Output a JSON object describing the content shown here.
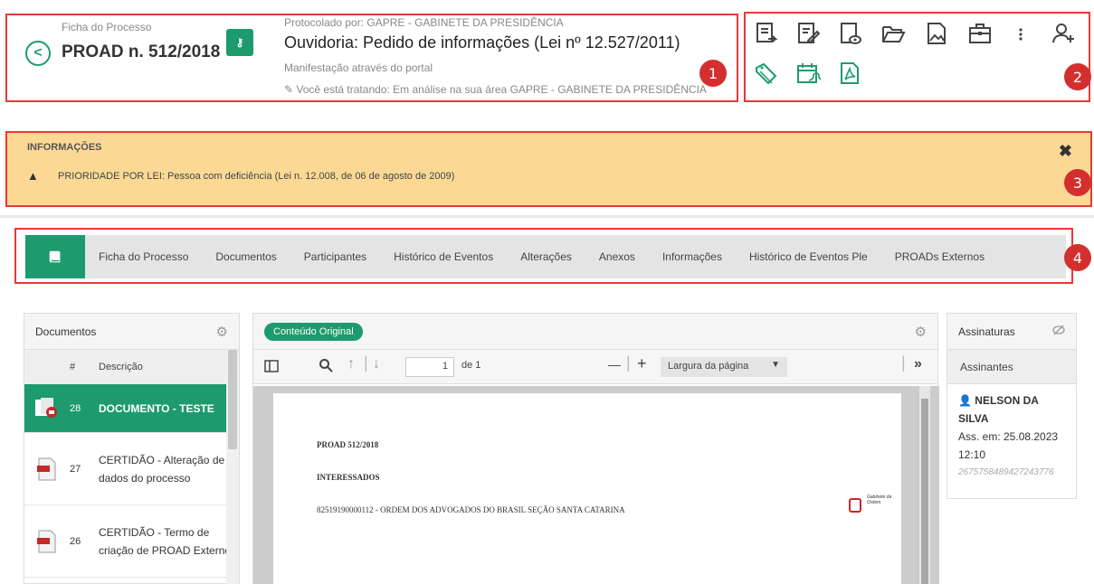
{
  "header": {
    "back_label": "<",
    "breadcrumb": "Ficha do Processo",
    "proad_number": "PROAD n. 512/2018",
    "key_icon_label": "⚷",
    "protocolado": "Protocolado por: GAPRE - GABINETE DA PRESIDÊNCIA",
    "title": "Ouvidoria: Pedido de informações (Lei nº 12.527/2011)",
    "manifestacao": "Manifestação através do portal",
    "status": "Você está tratando: Em análise na sua área GAPRE - GABINETE DA PRESIDÊNCIA"
  },
  "markers": [
    "1",
    "2",
    "3",
    "4"
  ],
  "info": {
    "title": "INFORMAÇÕES",
    "message": "PRIORIDADE POR LEI: Pessoa com deficiência (Lei n. 12.008, de 06 de agosto de 2009)",
    "close": "✖",
    "warning": "▲"
  },
  "tabs": [
    "Ficha do Processo",
    "Documentos",
    "Participantes",
    "Histórico de Eventos",
    "Alterações",
    "Anexos",
    "Informações",
    "Histórico de Eventos Ple",
    "PROADs Externos"
  ],
  "documents": {
    "title": "Documentos",
    "col_num": "#",
    "col_desc": "Descrição",
    "rows": [
      {
        "num": "28",
        "desc": "DOCUMENTO - TESTE",
        "active": true
      },
      {
        "num": "27",
        "desc": "CERTIDÃO - Alteração de dados do processo",
        "active": false
      },
      {
        "num": "26",
        "desc": "CERTIDÃO - Termo de criação de PROAD Externo",
        "active": false
      }
    ]
  },
  "viewer": {
    "badge": "Conteúdo Original",
    "page_value": "1",
    "page_of": "de 1",
    "minus": "—",
    "plus": "+",
    "zoom": "Largura da página",
    "more": "»",
    "pdf_lines": [
      "PROAD 512/2018",
      "INTERESSADOS",
      "82519190000112 - ORDEM DOS ADVOGADOS DO BRASIL SEÇÃO SANTA CATARINA"
    ],
    "stamp_text": "Gabinete da Ordem"
  },
  "signatures": {
    "title": "Assinaturas",
    "subtitle": "Assinantes",
    "name": "NELSON DA SILVA",
    "date": "Ass. em: 25.08.2023 12:10",
    "hash": "2675758489427243776"
  },
  "colors": {
    "accent": "#1d9b6e",
    "banner": "#fbd995",
    "marker": "#d32f2f"
  }
}
